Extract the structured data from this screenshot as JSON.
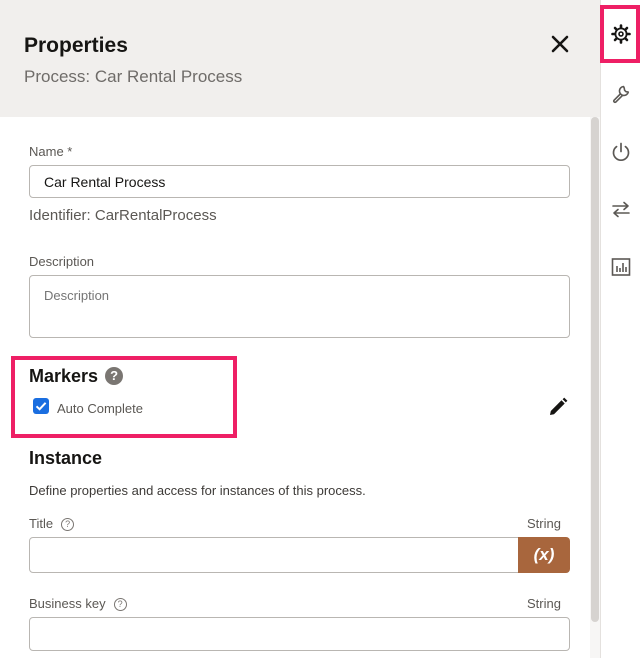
{
  "header": {
    "title": "Properties",
    "subtitle": "Process: Car Rental Process"
  },
  "general": {
    "name_label": "Name *",
    "name_value": "Car Rental Process",
    "identifier_text": "Identifier: CarRentalProcess",
    "description_label": "Description",
    "description_placeholder": "Description"
  },
  "markers": {
    "title": "Markers",
    "help_glyph": "?",
    "auto_complete_label": "Auto Complete",
    "auto_complete_checked": true
  },
  "instance": {
    "title": "Instance",
    "description": "Define properties and access for instances of this process.",
    "title_label": "Title",
    "title_type": "String",
    "title_value": "",
    "expression_button": "(x)",
    "business_key_label": "Business key",
    "business_key_type": "String",
    "business_key_value": "",
    "help_glyph": "?"
  },
  "rail": {
    "items": [
      "gear-icon",
      "wrench-icon",
      "power-icon",
      "swap-arrows-icon",
      "bar-chart-icon"
    ],
    "active": "gear-icon"
  },
  "colors": {
    "highlight": "#ee1f65",
    "header_bg": "#f1efed",
    "expression_button_bg": "#a8663d",
    "checkbox": "#1a6ee0"
  }
}
